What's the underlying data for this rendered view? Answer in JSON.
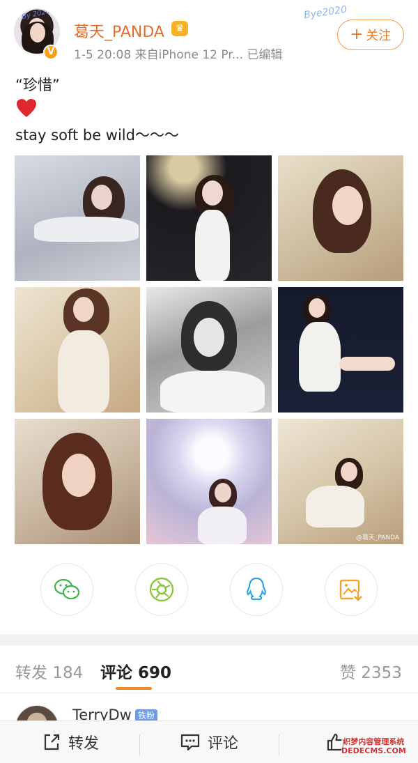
{
  "post": {
    "username": "葛天_PANDA",
    "meta": "1-5 20:08  来自iPhone 12 Pr...  已编辑",
    "avatar_tag": "By 2020",
    "deco_text": "Bye2020",
    "follow": {
      "plus": "+",
      "label": "关注"
    },
    "content_line1": "“珍惜”",
    "content_line3": "stay soft be wild～～～",
    "watermark_small": "@葛天_PANDA",
    "watermark_photo": "@葛天_PANDA"
  },
  "share": {
    "wechat_icon": "wechat-icon",
    "moments_icon": "moments-icon",
    "qq_icon": "qq-icon",
    "save_icon": "save-image-icon"
  },
  "tabs": {
    "repost": "转发 184",
    "comment": "评论 690",
    "like": "赞 2353"
  },
  "comment": {
    "name": "TerryDw",
    "badge": "铁粉"
  },
  "bottom_bar": {
    "repost": "转发",
    "comment": "评论",
    "watermark_line1": "织梦内容管理系统",
    "watermark_line2": "DEDECMS.COM"
  },
  "colors": {
    "accent": "#e36d2b",
    "brand_badge": "#f7a21b",
    "tab_indicator": "#f08a30"
  }
}
